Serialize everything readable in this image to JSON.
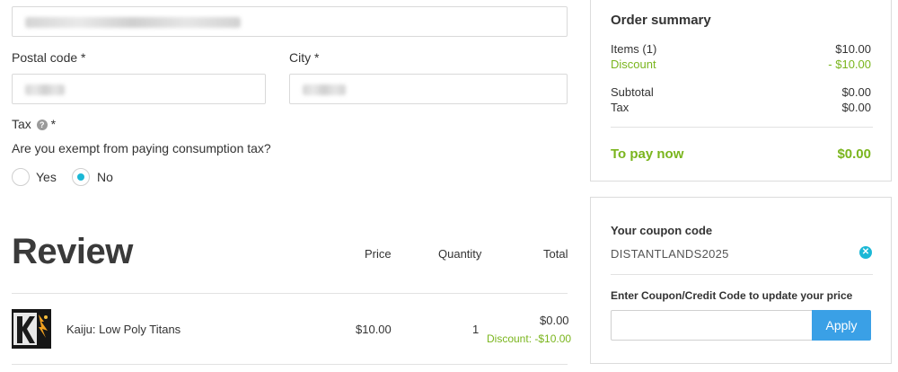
{
  "address": {
    "postal_label": "Postal code *",
    "city_label": "City *"
  },
  "tax": {
    "label": "Tax",
    "required_mark": "*",
    "question": "Are you exempt from paying consumption tax?",
    "options": [
      {
        "label": "Yes",
        "selected": false
      },
      {
        "label": "No",
        "selected": true
      }
    ]
  },
  "review": {
    "title": "Review",
    "columns": {
      "price": "Price",
      "quantity": "Quantity",
      "total": "Total"
    },
    "items": [
      {
        "name": "Kaiju: Low Poly Titans",
        "price": "$10.00",
        "quantity": "1",
        "total": "$0.00",
        "discount": "Discount: -$10.00"
      }
    ]
  },
  "order_summary": {
    "title": "Order summary",
    "rows": [
      {
        "label": "Items (1)",
        "value": "$10.00"
      },
      {
        "label": "Discount",
        "value": "- $10.00"
      },
      {
        "label": "Subtotal",
        "value": "$0.00"
      },
      {
        "label": "Tax",
        "value": "$0.00"
      }
    ],
    "to_pay_label": "To pay now",
    "to_pay_value": "$0.00"
  },
  "coupon": {
    "title": "Your coupon code",
    "code": "DISTANTLANDS2025",
    "enter_label": "Enter Coupon/Credit Code to update your price",
    "input_value": "",
    "apply_label": "Apply"
  },
  "colors": {
    "accent_green": "#7ab51d",
    "radio_blue": "#1bb8d6",
    "apply_blue": "#3aa0e6"
  }
}
